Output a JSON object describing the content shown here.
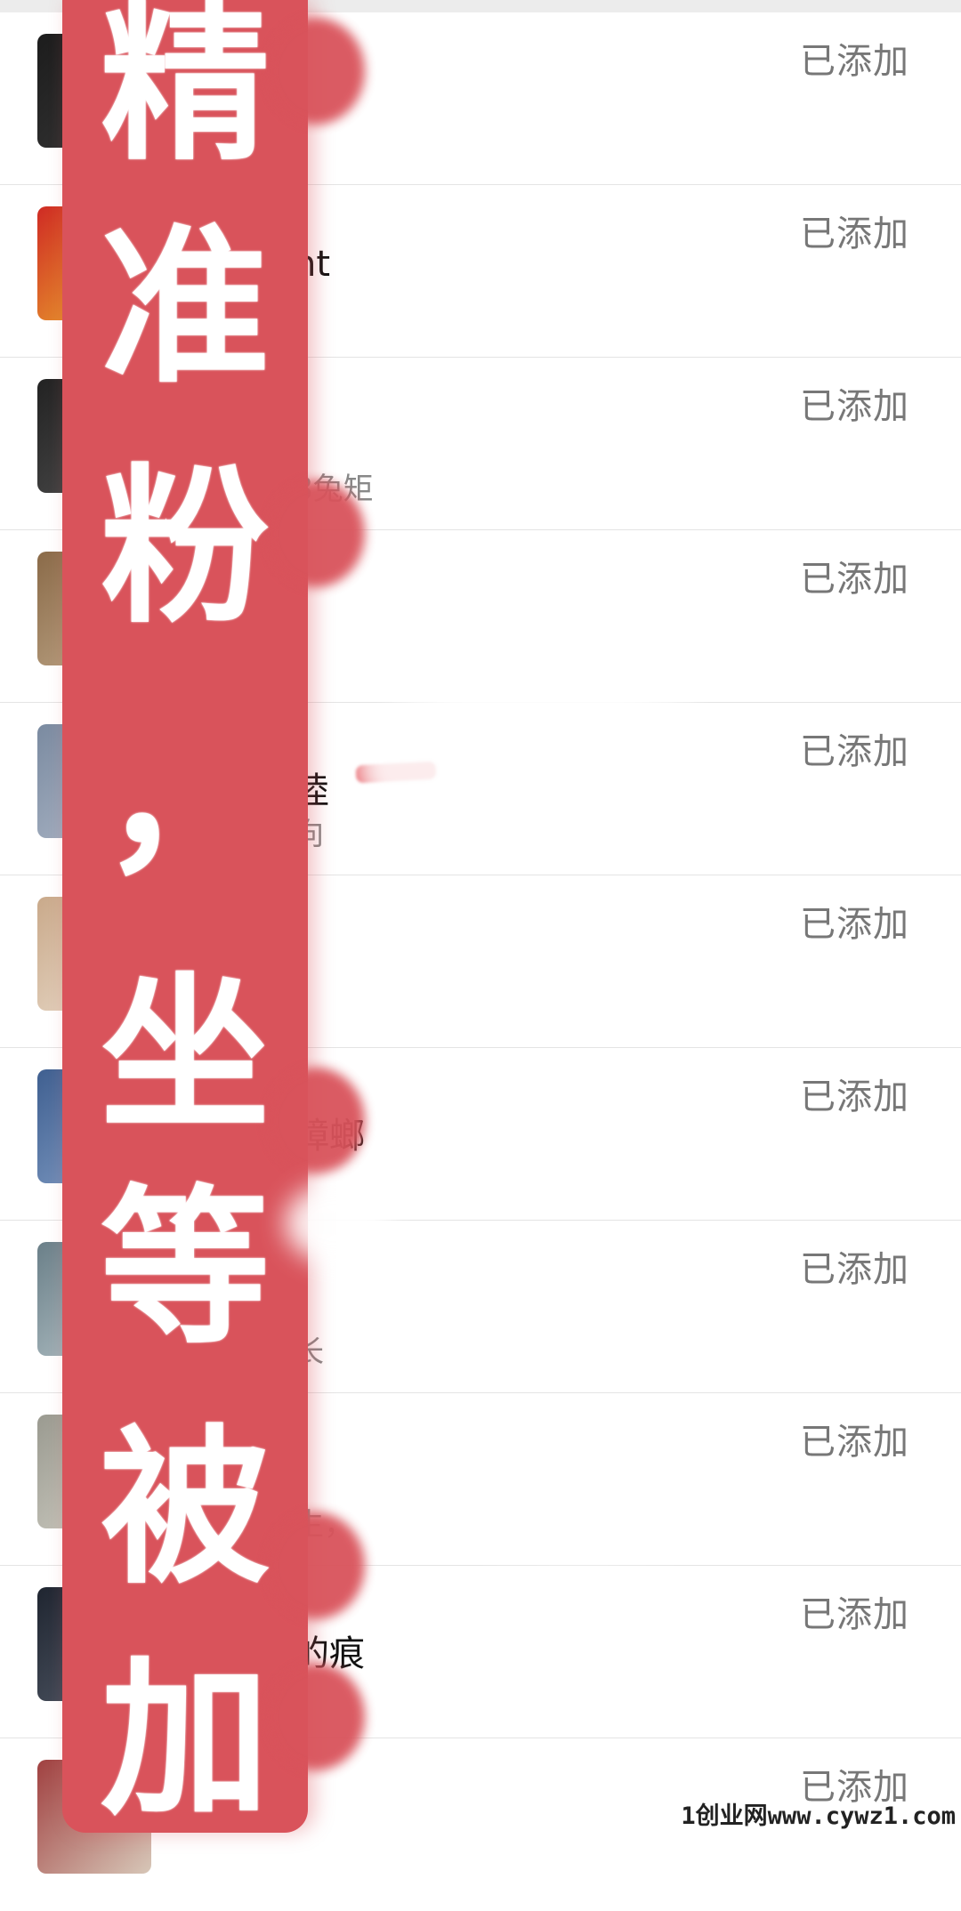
{
  "list": {
    "rows": [
      {
        "name": "",
        "subtitle": "",
        "status": "已添加",
        "avatar_colors": [
          "#1c1c1c",
          "#3a3a3a"
        ]
      },
      {
        "name": "ht",
        "subtitle": "",
        "status": "已添加",
        "avatar_colors": [
          "#cf2a24",
          "#f0c030"
        ]
      },
      {
        "name": "",
        "subtitle": "8兔矩",
        "status": "已添加",
        "avatar_colors": [
          "#222222",
          "#555555"
        ]
      },
      {
        "name": "",
        "subtitle": "",
        "status": "已添加",
        "avatar_colors": [
          "#8a6a48",
          "#c9b395"
        ]
      },
      {
        "name": "陸",
        "subtitle": "向",
        "status": "已添加",
        "avatar_colors": [
          "#7a8aa0",
          "#b7c0cf"
        ]
      },
      {
        "name": "",
        "subtitle": "",
        "status": "已添加",
        "avatar_colors": [
          "#c9a98a",
          "#efe4d6"
        ]
      },
      {
        "name": "蟑螂",
        "subtitle": "",
        "status": "已添加",
        "avatar_colors": [
          "#3f5f90",
          "#8ea9cf"
        ]
      },
      {
        "name": "",
        "subtitle": "长",
        "status": "已添加",
        "avatar_colors": [
          "#6a7f88",
          "#c3d0d4"
        ]
      },
      {
        "name": "",
        "subtitle": "生，",
        "status": "已添加",
        "avatar_colors": [
          "#9a9a90",
          "#d8d6cc"
        ]
      },
      {
        "name": "的痕",
        "subtitle": "",
        "status": "已添加",
        "avatar_colors": [
          "#1f2530",
          "#5a6270"
        ]
      },
      {
        "name": "",
        "subtitle": "",
        "status": "已添加",
        "avatar_colors": [
          "#a04040",
          "#d7c7b8"
        ]
      }
    ]
  },
  "overlay": {
    "chars": [
      "精",
      "准",
      "粉",
      "，",
      "坐",
      "等",
      "被",
      "加"
    ],
    "color": "#d9535b"
  },
  "watermark": "1创业网www.cywz1.com"
}
